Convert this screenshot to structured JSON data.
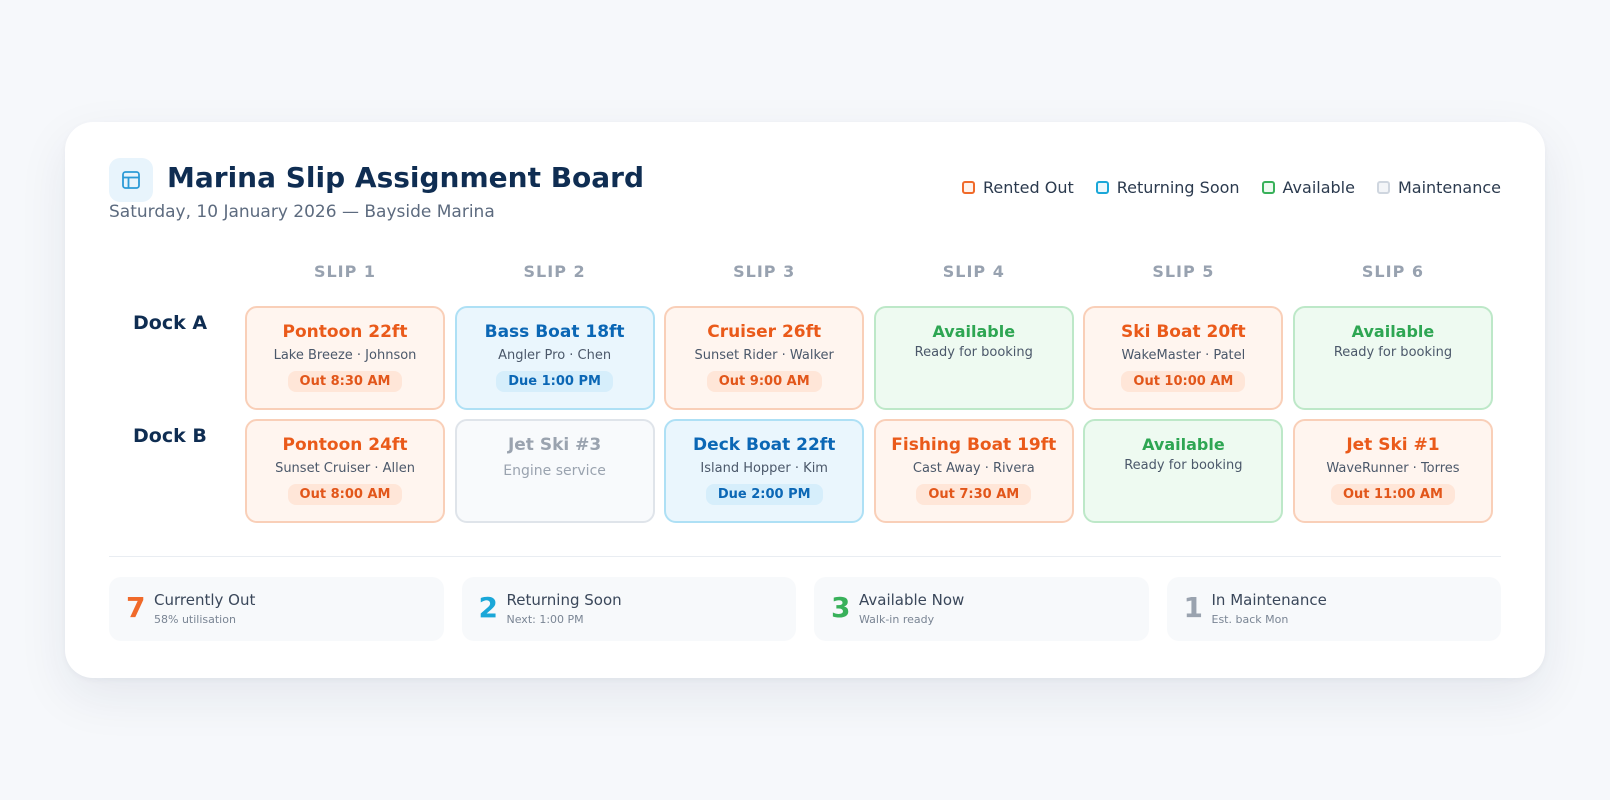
{
  "header": {
    "title": "Marina Slip Assignment Board",
    "subtitle": "Saturday, 10 January 2026 — Bayside Marina",
    "icon": "layout-icon"
  },
  "legend": [
    {
      "label": "Rented Out",
      "color": "#f06a2a"
    },
    {
      "label": "Returning Soon",
      "color": "#1aa7d8"
    },
    {
      "label": "Available",
      "color": "#38b15a"
    },
    {
      "label": "Maintenance",
      "color": "#cfd6df"
    }
  ],
  "slips": [
    "SLIP 1",
    "SLIP 2",
    "SLIP 3",
    "SLIP 4",
    "SLIP 5",
    "SLIP 6"
  ],
  "docks": [
    {
      "name": "Dock A",
      "slots": [
        {
          "status": "rented",
          "boat": "Pontoon 22ft",
          "detail": "Lake Breeze · Johnson",
          "pill": "Out 8:30 AM"
        },
        {
          "status": "returning",
          "boat": "Bass Boat 18ft",
          "detail": "Angler Pro · Chen",
          "pill": "Due 1:00 PM"
        },
        {
          "status": "rented",
          "boat": "Cruiser 26ft",
          "detail": "Sunset Rider · Walker",
          "pill": "Out 9:00 AM"
        },
        {
          "status": "available",
          "boat": "Available",
          "detail": "Ready for booking",
          "pill": ""
        },
        {
          "status": "rented",
          "boat": "Ski Boat 20ft",
          "detail": "WakeMaster · Patel",
          "pill": "Out 10:00 AM"
        },
        {
          "status": "available",
          "boat": "Available",
          "detail": "Ready for booking",
          "pill": ""
        }
      ]
    },
    {
      "name": "Dock B",
      "slots": [
        {
          "status": "rented",
          "boat": "Pontoon 24ft",
          "detail": "Sunset Cruiser · Allen",
          "pill": "Out 8:00 AM"
        },
        {
          "status": "maint",
          "boat": "Jet Ski #3",
          "detail": "Engine service",
          "pill": ""
        },
        {
          "status": "returning",
          "boat": "Deck Boat 22ft",
          "detail": "Island Hopper · Kim",
          "pill": "Due 2:00 PM"
        },
        {
          "status": "rented",
          "boat": "Fishing Boat 19ft",
          "detail": "Cast Away · Rivera",
          "pill": "Out 7:30 AM"
        },
        {
          "status": "available",
          "boat": "Available",
          "detail": "Ready for booking",
          "pill": ""
        },
        {
          "status": "rented",
          "boat": "Jet Ski #1",
          "detail": "WaveRunner · Torres",
          "pill": "Out 11:00 AM"
        }
      ]
    }
  ],
  "stats": [
    {
      "number": "7",
      "label": "Currently Out",
      "sub": "58% utilisation",
      "color": "#f06a2a"
    },
    {
      "number": "2",
      "label": "Returning Soon",
      "sub": "Next: 1:00 PM",
      "color": "#1aa7d8"
    },
    {
      "number": "3",
      "label": "Available Now",
      "sub": "Walk-in ready",
      "color": "#38b15a"
    },
    {
      "number": "1",
      "label": "In Maintenance",
      "sub": "Est. back Mon",
      "color": "#9aa3af"
    }
  ]
}
